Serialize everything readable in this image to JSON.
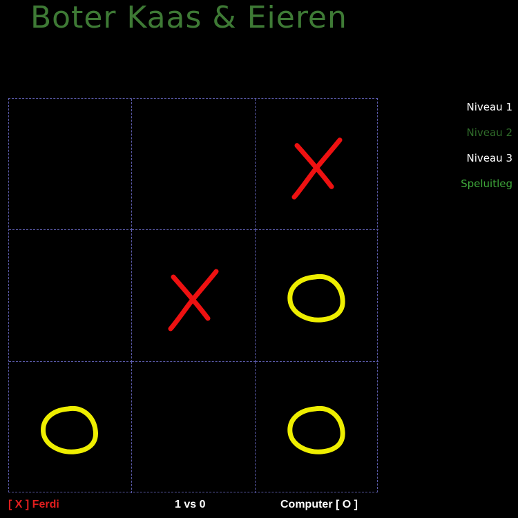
{
  "title": "Boter Kaas & Eieren",
  "menu": {
    "items": [
      {
        "label": "Niveau 1",
        "color": "#ffffff"
      },
      {
        "label": "Niveau 2",
        "color": "#2f6b2a"
      },
      {
        "label": "Niveau 3",
        "color": "#ffffff"
      },
      {
        "label": "Speluitleg",
        "color": "#3ea83a"
      }
    ]
  },
  "board": {
    "cells": [
      "",
      "",
      "X",
      "",
      "X",
      "O",
      "O",
      "",
      "O"
    ],
    "x_color": "#ee1111",
    "o_color": "#eeee00",
    "grid_color": "#5a5aa8"
  },
  "footer": {
    "player1": "[ X ] Ferdi",
    "score": "1 vs 0",
    "player2": "Computer [ O ]"
  },
  "colors": {
    "title": "#3e7a35",
    "player1": "#e01e1e",
    "background": "#000000"
  }
}
